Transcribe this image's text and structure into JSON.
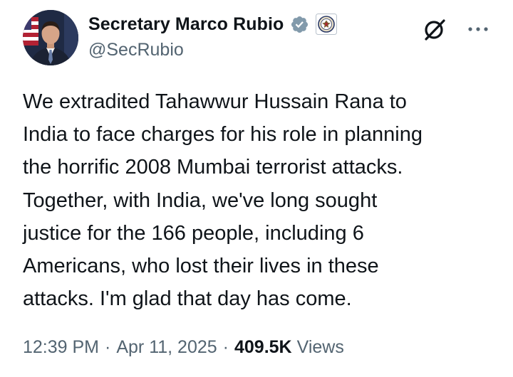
{
  "author": {
    "display_name": "Secretary Marco Rubio",
    "handle": "@SecRubio",
    "verified_icon": "verified-badge-gray-icon",
    "affiliation_icon": "us-department-of-state-seal-icon",
    "avatar": "profile-photo"
  },
  "actions": {
    "grok_icon": "grok-icon",
    "more_icon": "more-dots-icon"
  },
  "tweet": {
    "lines": [
      "We extradited Tahawwur Hussain Rana to",
      "India to face charges for his role in planning",
      "the horrific 2008 Mumbai terrorist attacks.",
      "Together, with India, we've long sought",
      "justice for the 166 people, including 6",
      "Americans, who lost their lives in these",
      "attacks. I'm glad that day has come."
    ]
  },
  "meta": {
    "time": "12:39 PM",
    "separator": "·",
    "date": "Apr 11, 2025",
    "views_count": "409.5K",
    "views_label": "Views"
  },
  "colors": {
    "text": "#0f1419",
    "secondary": "#536471",
    "verified_gray": "#829aab"
  }
}
